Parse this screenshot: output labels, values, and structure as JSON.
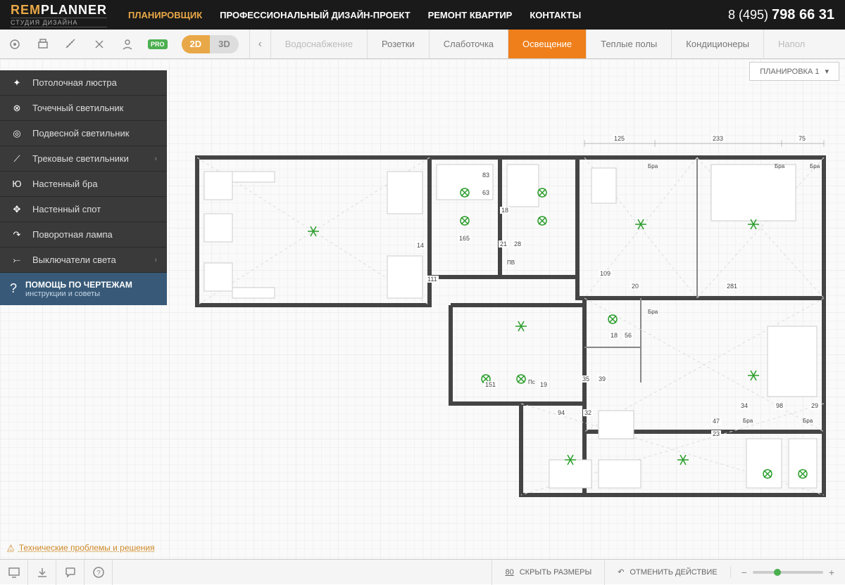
{
  "logo": {
    "line1a": "REM",
    "line1b": "PLANNER",
    "line2": "СТУДИЯ ДИЗАЙНА"
  },
  "nav": [
    {
      "label": "ПЛАНИРОВЩИК",
      "active": true
    },
    {
      "label": "ПРОФЕССИОНАЛЬНЫЙ ДИЗАЙН-ПРОЕКТ",
      "active": false
    },
    {
      "label": "РЕМОНТ КВАРТИР",
      "active": false
    },
    {
      "label": "КОНТАКТЫ",
      "active": false
    }
  ],
  "phone": {
    "prefix": "8 (495) ",
    "number": "798 66 31"
  },
  "pro": "PRO",
  "view": {
    "d2": "2D",
    "d3": "3D"
  },
  "plan_tabs": [
    {
      "label": "Водоснабжение",
      "dim": true
    },
    {
      "label": "Розетки"
    },
    {
      "label": "Слаботочка"
    },
    {
      "label": "Освещение",
      "active": true
    },
    {
      "label": "Теплые полы"
    },
    {
      "label": "Кондиционеры"
    },
    {
      "label": "Напол",
      "dim": true
    }
  ],
  "layout_selector": "ПЛАНИРОВКА 1",
  "sidebar": {
    "items": [
      {
        "label": "Потолочная люстра"
      },
      {
        "label": "Точечный светильник"
      },
      {
        "label": "Подвесной светильник"
      },
      {
        "label": "Трековые светильники",
        "sub": true
      },
      {
        "label": "Настенный бра"
      },
      {
        "label": "Настенный спот"
      },
      {
        "label": "Поворотная лампа"
      },
      {
        "label": "Выключатели света",
        "sub": true
      }
    ],
    "help": {
      "title": "ПОМОЩЬ ПО ЧЕРТЕЖАМ",
      "sub": "инструкции и советы"
    }
  },
  "dimensions": {
    "top": [
      {
        "v": "125"
      },
      {
        "v": "233"
      },
      {
        "v": "75"
      }
    ],
    "labels": [
      "Бра",
      "Бра",
      "Бра",
      "Бра",
      "Бра",
      "Бра",
      "ПВ",
      "Пс"
    ],
    "misc": [
      "83",
      "63",
      "18",
      "14",
      "165",
      "21",
      "28",
      "111",
      "109",
      "20",
      "281",
      "18",
      "56",
      "151",
      "19",
      "35",
      "39",
      "94",
      "32",
      "34",
      "98",
      "29",
      "47",
      "23"
    ]
  },
  "tech_link": "Технические проблемы и решения",
  "footer": {
    "hide_sizes": "СКРЫТЬ РАЗМЕРЫ",
    "hide_sizes_count": "80",
    "undo": "ОТМЕНИТЬ ДЕЙСТВИЕ"
  }
}
